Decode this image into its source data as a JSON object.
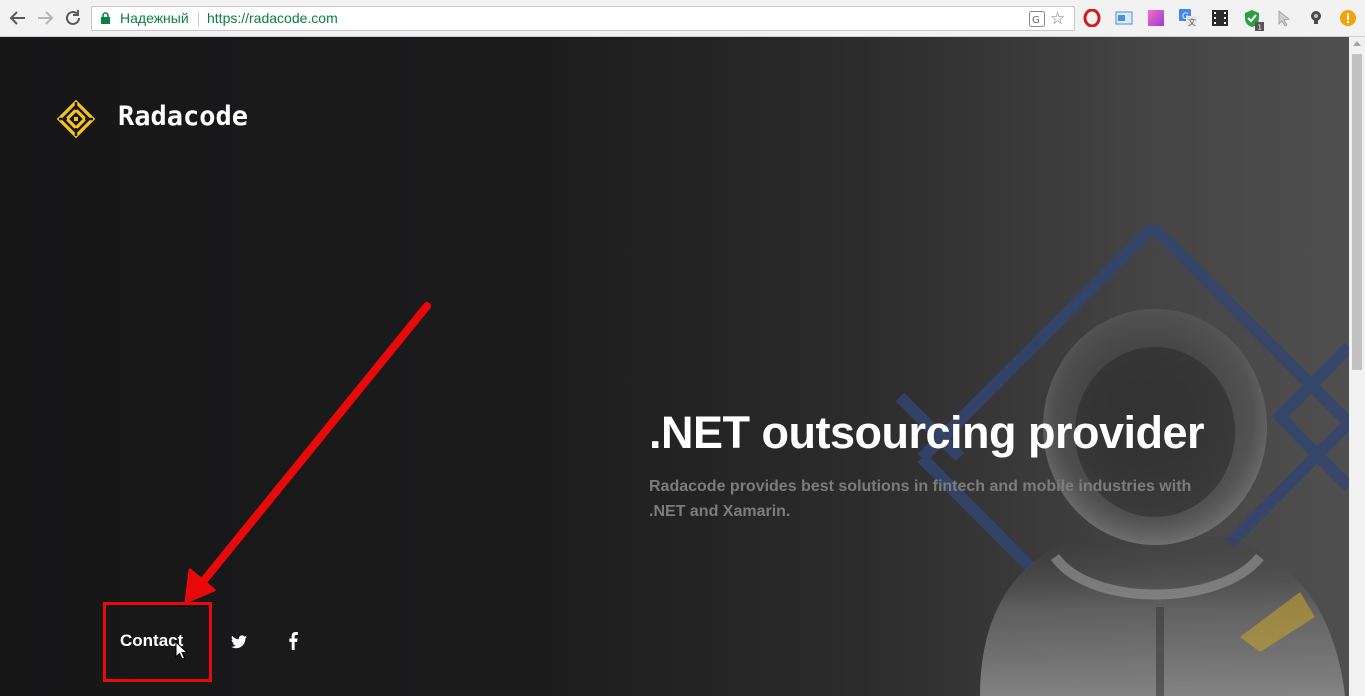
{
  "browser": {
    "back_icon": "arrow-left-icon",
    "forward_icon": "arrow-right-icon",
    "reload_icon": "reload-icon",
    "secure_label": "Надежный",
    "url": "https://radacode.com",
    "translate_icon": "translate-icon",
    "bookmark_icon": "star-icon",
    "extensions": [
      {
        "name": "opera-icon",
        "color": "#d11c1c"
      },
      {
        "name": "screenshot-icon",
        "color": "#4a90d9"
      },
      {
        "name": "color-picker-icon",
        "color": "#e03c9b"
      },
      {
        "name": "google-translate-icon",
        "color": "#4285f4"
      },
      {
        "name": "film-icon",
        "color": "#333333"
      },
      {
        "name": "shield-icon",
        "color": "#2e9e3f",
        "badge": "1"
      },
      {
        "name": "cursor-icon",
        "color": "#aaaaaa"
      },
      {
        "name": "lightbulb-icon",
        "color": "#555555"
      },
      {
        "name": "alert-icon",
        "color": "#f0a30a"
      }
    ]
  },
  "site": {
    "brand": "Radacode",
    "brand_color": "#f5c518",
    "hero_title": ".NET outsourcing provider",
    "hero_subtitle": "Radacode provides best solutions in fintech and mobile industries with .NET and Xamarin.",
    "footer": {
      "contact_label": "Contact",
      "twitter_icon": "twitter-icon",
      "facebook_icon": "facebook-icon"
    }
  },
  "annotation": {
    "color": "#e8090b"
  }
}
